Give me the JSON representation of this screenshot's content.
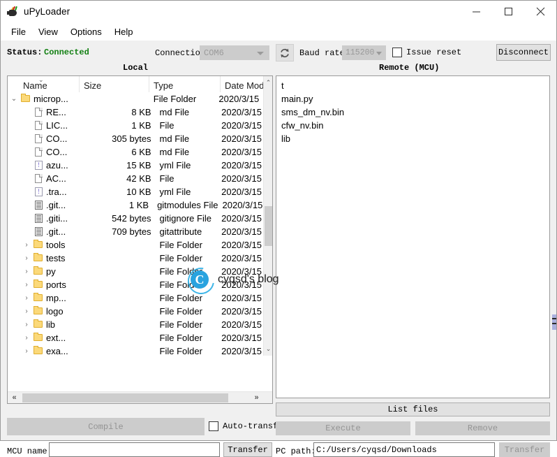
{
  "window": {
    "title": "uPyLoader",
    "icon": "plug-icon",
    "controls": {
      "minimize": "minimize-icon",
      "maximize": "maximize-icon",
      "close": "close-icon"
    }
  },
  "menubar": {
    "items": [
      {
        "label": "File"
      },
      {
        "label": "View"
      },
      {
        "label": "Options"
      },
      {
        "label": "Help"
      }
    ]
  },
  "statusbar": {
    "status_label": "Status:",
    "status_value": "Connected",
    "status_color": "#138013",
    "connection_label": "Connection",
    "connection_value": "COM6",
    "refresh_icon": "refresh-icon",
    "baud_label": "Baud rate:",
    "baud_value": "115200",
    "issue_reset_label": "Issue reset",
    "issue_reset_checked": false,
    "disconnect_label": "Disconnect"
  },
  "panels": {
    "local_caption": "Local",
    "remote_caption": "Remote (MCU)"
  },
  "local_tree": {
    "columns": [
      {
        "key": "name",
        "label": "Name"
      },
      {
        "key": "size",
        "label": "Size"
      },
      {
        "key": "type",
        "label": "Type"
      },
      {
        "key": "date",
        "label": "Date Mod"
      }
    ],
    "sort_indicator": "⌄",
    "rows": [
      {
        "indent": 0,
        "expander": "⌄",
        "icon": "folder",
        "name": "microp...",
        "size": "",
        "type": "File Folder",
        "date": "2020/3/15"
      },
      {
        "indent": 1,
        "expander": "",
        "icon": "file",
        "name": "RE...",
        "size": "8 KB",
        "type": "md File",
        "date": "2020/3/15"
      },
      {
        "indent": 1,
        "expander": "",
        "icon": "file",
        "name": "LIC...",
        "size": "1 KB",
        "type": "File",
        "date": "2020/3/15"
      },
      {
        "indent": 1,
        "expander": "",
        "icon": "file",
        "name": "CO...",
        "size": "305 bytes",
        "type": "md File",
        "date": "2020/3/15"
      },
      {
        "indent": 1,
        "expander": "",
        "icon": "file",
        "name": "CO...",
        "size": "6 KB",
        "type": "md File",
        "date": "2020/3/15"
      },
      {
        "indent": 1,
        "expander": "",
        "icon": "yml",
        "name": "azu...",
        "size": "15 KB",
        "type": "yml File",
        "date": "2020/3/15"
      },
      {
        "indent": 1,
        "expander": "",
        "icon": "file",
        "name": "AC...",
        "size": "42 KB",
        "type": "File",
        "date": "2020/3/15"
      },
      {
        "indent": 1,
        "expander": "",
        "icon": "yml",
        "name": ".tra...",
        "size": "10 KB",
        "type": "yml File",
        "date": "2020/3/15"
      },
      {
        "indent": 1,
        "expander": "",
        "icon": "text",
        "name": ".git...",
        "size": "1 KB",
        "type": "gitmodules File",
        "date": "2020/3/15"
      },
      {
        "indent": 1,
        "expander": "",
        "icon": "text",
        "name": ".giti...",
        "size": "542 bytes",
        "type": "gitignore File",
        "date": "2020/3/15"
      },
      {
        "indent": 1,
        "expander": "",
        "icon": "text",
        "name": ".git...",
        "size": "709 bytes",
        "type": "gitattribute",
        "date": "2020/3/15"
      },
      {
        "indent": 1,
        "expander": "›",
        "icon": "folder",
        "name": "tools",
        "size": "",
        "type": "File Folder",
        "date": "2020/3/15"
      },
      {
        "indent": 1,
        "expander": "›",
        "icon": "folder",
        "name": "tests",
        "size": "",
        "type": "File Folder",
        "date": "2020/3/15"
      },
      {
        "indent": 1,
        "expander": "›",
        "icon": "folder",
        "name": "py",
        "size": "",
        "type": "File Folder",
        "date": "2020/3/15"
      },
      {
        "indent": 1,
        "expander": "›",
        "icon": "folder",
        "name": "ports",
        "size": "",
        "type": "File Folder",
        "date": "2020/3/15"
      },
      {
        "indent": 1,
        "expander": "›",
        "icon": "folder",
        "name": "mp...",
        "size": "",
        "type": "File Folder",
        "date": "2020/3/15"
      },
      {
        "indent": 1,
        "expander": "›",
        "icon": "folder",
        "name": "logo",
        "size": "",
        "type": "File Folder",
        "date": "2020/3/15"
      },
      {
        "indent": 1,
        "expander": "›",
        "icon": "folder",
        "name": "lib",
        "size": "",
        "type": "File Folder",
        "date": "2020/3/15"
      },
      {
        "indent": 1,
        "expander": "›",
        "icon": "folder",
        "name": "ext...",
        "size": "",
        "type": "File Folder",
        "date": "2020/3/15"
      },
      {
        "indent": 1,
        "expander": "›",
        "icon": "folder",
        "name": "exa...",
        "size": "",
        "type": "File Folder",
        "date": "2020/3/15"
      }
    ],
    "scroll": {
      "up_arrow": "⌃",
      "down_arrow": "⌄",
      "left_arrow": "«",
      "right_arrow": "»"
    }
  },
  "remote_list": {
    "items": [
      {
        "name": "t"
      },
      {
        "name": "main.py"
      },
      {
        "name": "sms_dm_nv.bin"
      },
      {
        "name": "cfw_nv.bin"
      },
      {
        "name": "lib"
      }
    ]
  },
  "bottom": {
    "compile_label": "Compile",
    "compile_enabled": false,
    "auto_transfer_label": "Auto-transfe",
    "auto_transfer_checked": false,
    "list_files_label": "List files",
    "list_files_enabled": true,
    "execute_label": "Execute",
    "execute_enabled": false,
    "remove_label": "Remove",
    "remove_enabled": false,
    "mcu_name_label": "MCU name:",
    "mcu_name_value": "",
    "mcu_name_placeholder": "",
    "mcu_transfer_label": "Transfer",
    "mcu_transfer_enabled": true,
    "pc_path_label": "PC path:",
    "pc_path_value": "C:/Users/cyqsd/Downloads",
    "pc_path_placeholder": "",
    "pc_transfer_label": "Transfer",
    "pc_transfer_enabled": false
  },
  "watermark": {
    "text": "cyqsd's blog",
    "logo_letter": "C",
    "logo_color": "#29a3df"
  }
}
